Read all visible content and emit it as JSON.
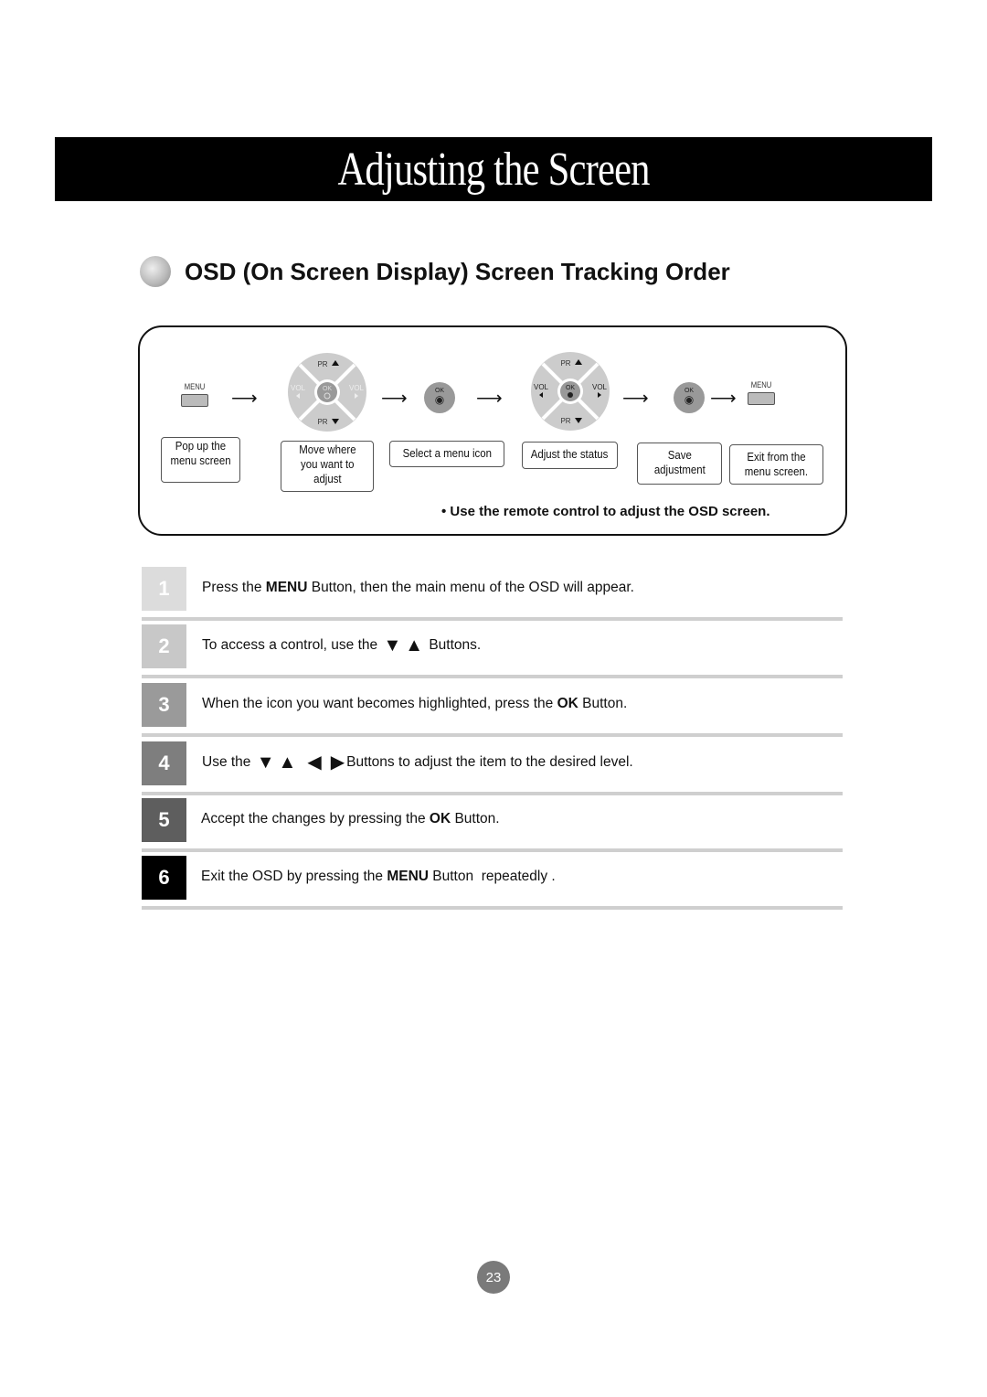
{
  "header": {
    "title": "Adjusting the Screen"
  },
  "section": {
    "title": "OSD (On Screen Display) Screen Tracking Order"
  },
  "diagram": {
    "menu_label": "MENU",
    "ok_label": "OK",
    "pr_up": "PR",
    "pr_down": "PR",
    "vol_left": "VOL",
    "vol_right": "VOL",
    "captions": [
      [
        "Pop up the",
        "menu screen"
      ],
      [
        "Move where",
        "you want to",
        "adjust"
      ],
      [
        "Select a menu icon"
      ],
      [
        "Adjust the status"
      ],
      [
        "Save",
        "adjustment"
      ],
      [
        "Exit from the",
        "menu screen."
      ]
    ],
    "note": "• Use the remote control to adjust the OSD screen."
  },
  "steps": [
    {
      "num": "1",
      "color": "#dcdcdc",
      "pre": "Press the ",
      "bold": "MENU",
      "post": " Button, then the main menu of the OSD will appear."
    },
    {
      "num": "2",
      "color": "#c8c8c8",
      "pre": "To access a control, use the ",
      "icons": [
        "▼",
        "▲"
      ],
      "post": " Buttons."
    },
    {
      "num": "3",
      "color": "#9a9a9a",
      "pre": "When the icon you want becomes highlighted, press the ",
      "bold": "OK",
      "post": " Button."
    },
    {
      "num": "4",
      "color": "#7e7e7e",
      "pre": "Use the ",
      "icons": [
        "▼",
        "▲",
        "◀",
        "▶"
      ],
      "post": "Buttons to adjust the item to the desired level."
    },
    {
      "num": "5",
      "color": "#5e5e5e",
      "pre": "Accept the changes by pressing the ",
      "bold": "OK",
      "post": " Button."
    },
    {
      "num": "6",
      "color": "#000000",
      "pre": "Exit the OSD by pressing the ",
      "bold": "MENU",
      "post": " Button  repeatedly ."
    }
  ],
  "footer": {
    "page_number": "23"
  }
}
